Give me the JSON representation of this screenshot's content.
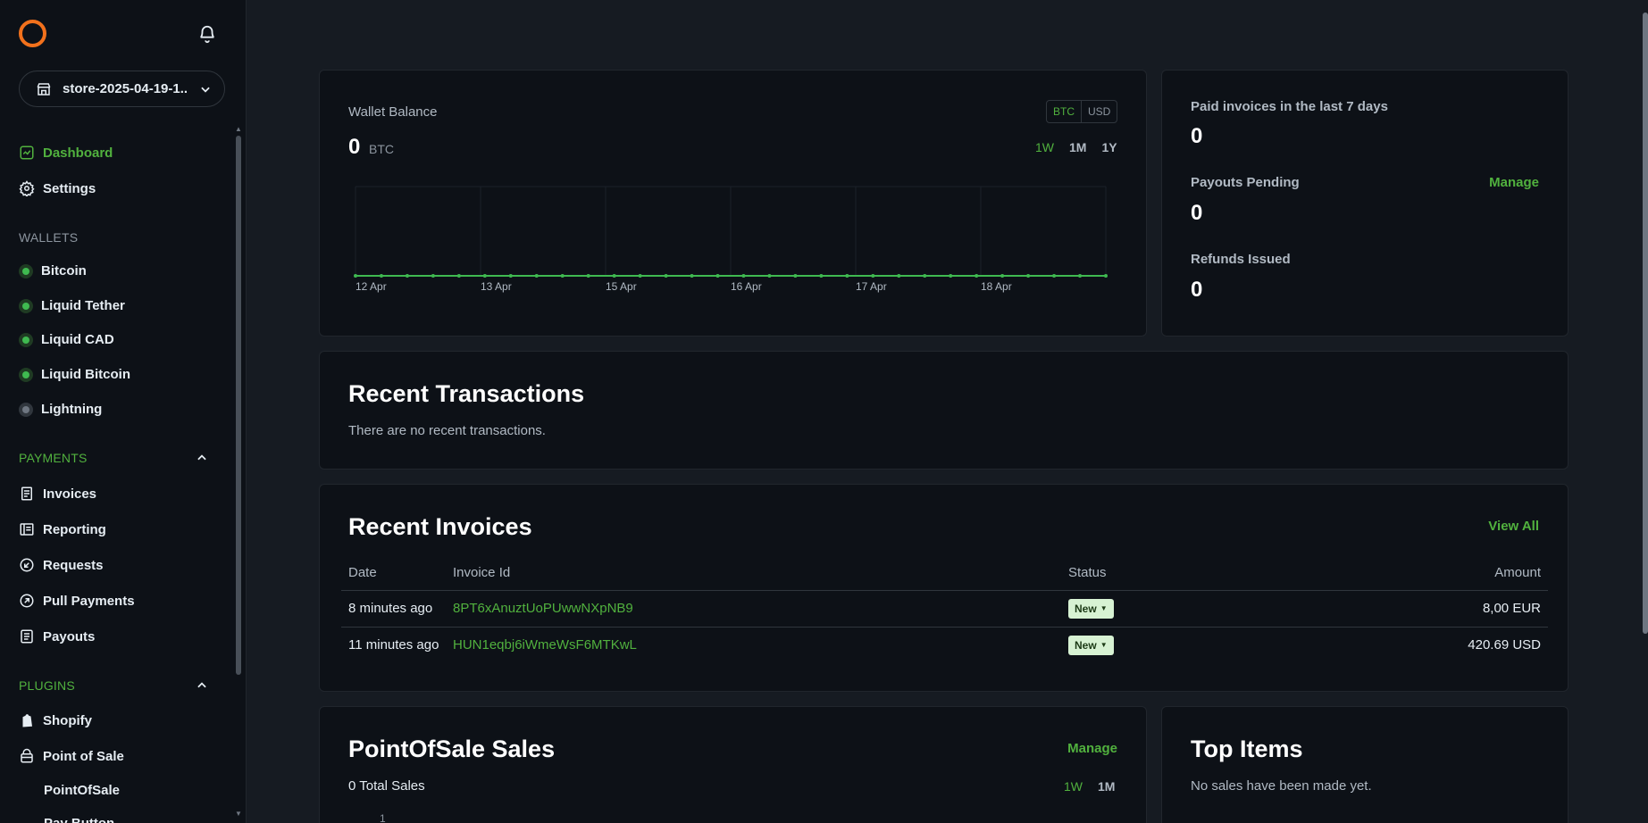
{
  "sidebar": {
    "store_name": "store-2025-04-19-1...",
    "nav": [
      {
        "label": "Dashboard",
        "icon": "dashboard-icon",
        "active": true
      },
      {
        "label": "Settings",
        "icon": "gear-icon"
      }
    ],
    "wallets_heading": "WALLETS",
    "wallets": [
      {
        "label": "Bitcoin",
        "status": "on"
      },
      {
        "label": "Liquid Tether",
        "status": "on"
      },
      {
        "label": "Liquid CAD",
        "status": "on"
      },
      {
        "label": "Liquid Bitcoin",
        "status": "on"
      },
      {
        "label": "Lightning",
        "status": "off"
      }
    ],
    "payments_heading": "PAYMENTS",
    "payments": [
      {
        "label": "Invoices",
        "icon": "invoice-icon"
      },
      {
        "label": "Reporting",
        "icon": "reporting-icon"
      },
      {
        "label": "Requests",
        "icon": "requests-icon"
      },
      {
        "label": "Pull Payments",
        "icon": "pull-payments-icon"
      },
      {
        "label": "Payouts",
        "icon": "payouts-icon"
      }
    ],
    "plugins_heading": "PLUGINS",
    "plugins": [
      {
        "label": "Shopify",
        "icon": "shopify-icon"
      },
      {
        "label": "Point of Sale",
        "icon": "point-of-sale-icon"
      },
      {
        "label": "PointOfSale",
        "icon": ""
      }
    ],
    "truncated_item": "Pay Button"
  },
  "wallet": {
    "title": "Wallet Balance",
    "amount": "0",
    "unit": "BTC",
    "currency_options": [
      "BTC",
      "USD"
    ],
    "selected_currency": "BTC",
    "ranges": [
      "1W",
      "1M",
      "1Y"
    ],
    "selected_range": "1W"
  },
  "chart_data": {
    "type": "line",
    "x": [
      "12 Apr",
      "13 Apr",
      "15 Apr",
      "16 Apr",
      "17 Apr",
      "18 Apr"
    ],
    "tick_labels": [
      "12 Apr",
      "13 Apr",
      "15 Apr",
      "16 Apr",
      "17 Apr",
      "18 Apr"
    ],
    "point_count": 30,
    "values_all": 0,
    "series": [
      {
        "values": [
          0,
          0,
          0,
          0,
          0,
          0,
          0,
          0,
          0,
          0,
          0,
          0,
          0,
          0,
          0,
          0,
          0,
          0,
          0,
          0,
          0,
          0,
          0,
          0,
          0,
          0,
          0,
          0,
          0,
          0
        ]
      }
    ],
    "grid": true,
    "line_color": "#3fb950"
  },
  "stats": {
    "paid_label": "Paid invoices in the last 7 days",
    "paid_value": "0",
    "payouts_label": "Payouts Pending",
    "payouts_manage": "Manage",
    "payouts_value": "0",
    "refunds_label": "Refunds Issued",
    "refunds_value": "0"
  },
  "transactions": {
    "title": "Recent Transactions",
    "empty": "There are no recent transactions."
  },
  "invoices": {
    "title": "Recent Invoices",
    "view_all": "View All",
    "columns": {
      "date": "Date",
      "id": "Invoice Id",
      "status": "Status",
      "amount": "Amount"
    },
    "rows": [
      {
        "date": "8 minutes ago",
        "id": "8PT6xAnuztUoPUwwNXpNB9",
        "status": "New",
        "amount": "8,00 EUR"
      },
      {
        "date": "11 minutes ago",
        "id": "HUN1eqbj6iWmeWsF6MTKwL",
        "status": "New",
        "amount": "420.69 USD"
      }
    ]
  },
  "pos": {
    "title": "PointOfSale Sales",
    "manage": "Manage",
    "total": "0 Total Sales",
    "ranges": [
      "1W",
      "1M"
    ],
    "selected_range": "1W",
    "axis_first_tick": "1"
  },
  "top_items": {
    "title": "Top Items",
    "empty": "No sales have been made yet."
  }
}
